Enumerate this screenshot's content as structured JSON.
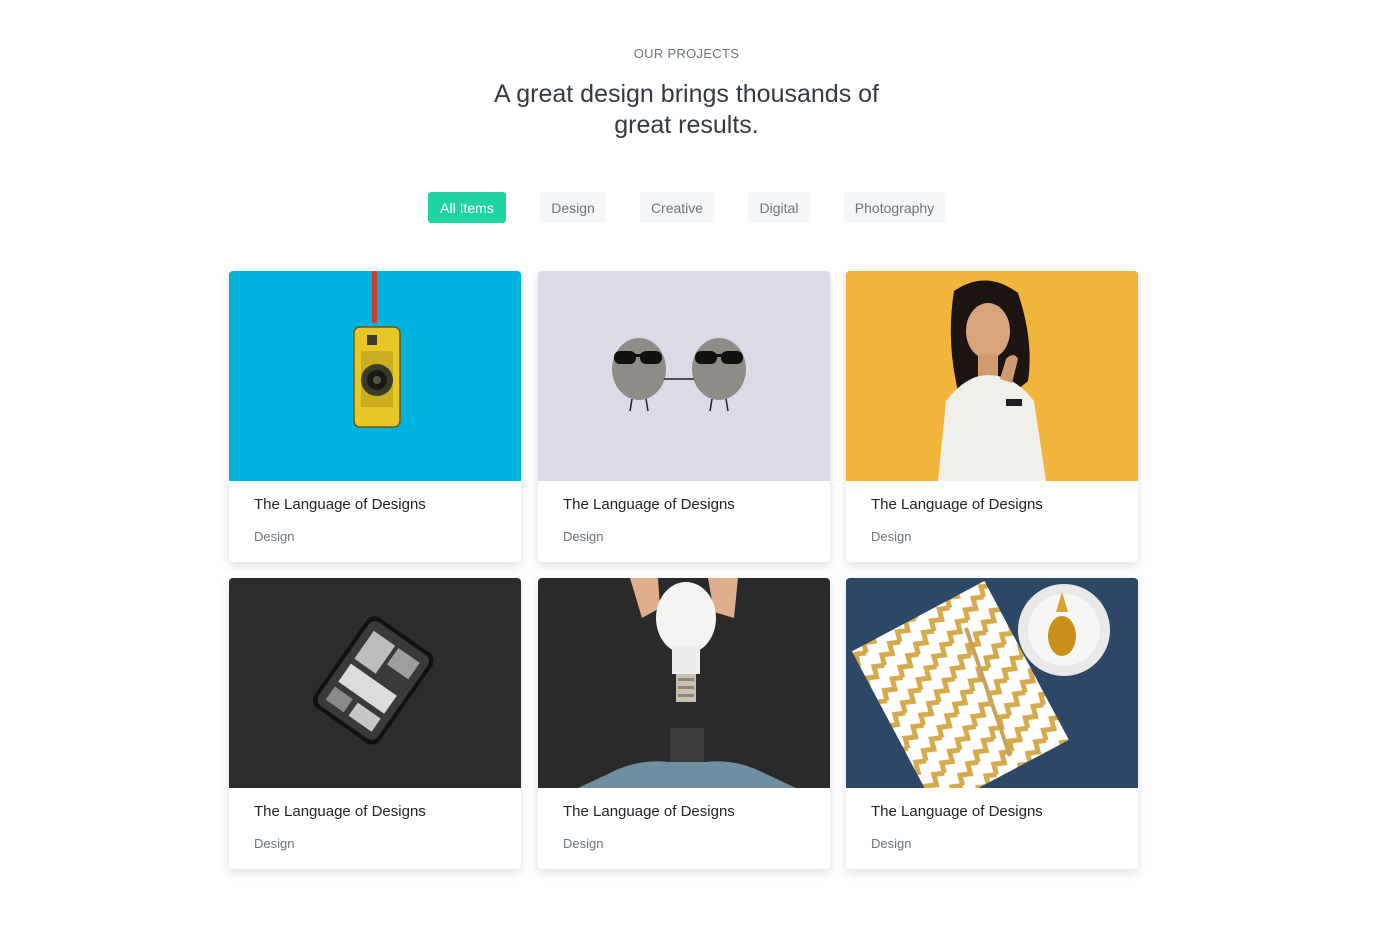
{
  "section": {
    "eyebrow": "OUR PROJECTS",
    "headline_line1": "A great design brings thousands of",
    "headline_line2": "great results."
  },
  "filters": [
    {
      "label": "All Items",
      "active": true
    },
    {
      "label": "Design",
      "active": false
    },
    {
      "label": "Creative",
      "active": false
    },
    {
      "label": "Digital",
      "active": false
    },
    {
      "label": "Photography",
      "active": false
    }
  ],
  "colors": {
    "accent": "#20d3a2",
    "filter_bg": "#f5f6f7",
    "muted_text": "#6c757d"
  },
  "projects": [
    {
      "title": "The Language of Designs",
      "category": "Design",
      "image": "yellow-phone-case-on-blue"
    },
    {
      "title": "The Language of Designs",
      "category": "Design",
      "image": "stones-with-sunglasses"
    },
    {
      "title": "The Language of Designs",
      "category": "Design",
      "image": "smiling-woman-on-yellow"
    },
    {
      "title": "The Language of Designs",
      "category": "Design",
      "image": "transparent-smartphone-on-dark"
    },
    {
      "title": "The Language of Designs",
      "category": "Design",
      "image": "hand-holding-light-bulb"
    },
    {
      "title": "The Language of Designs",
      "category": "Design",
      "image": "notebook-and-pineapple-plate"
    }
  ]
}
